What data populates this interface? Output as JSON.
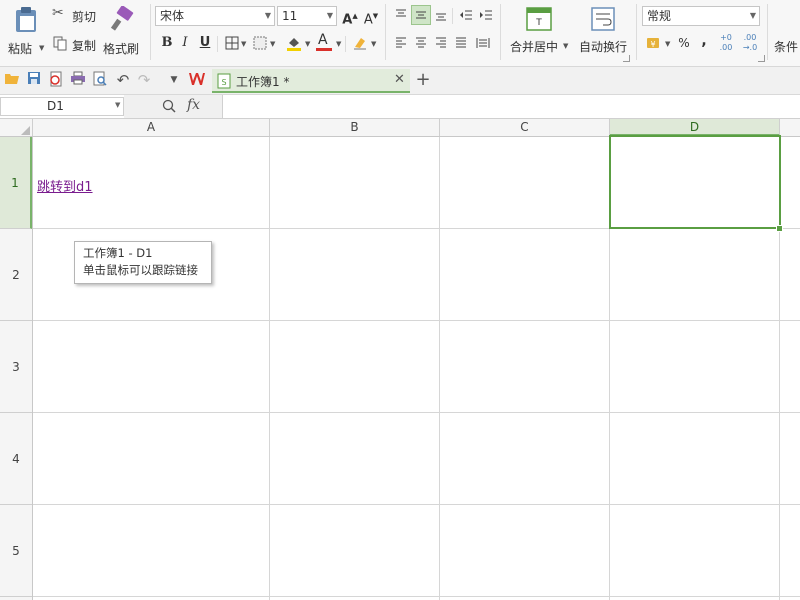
{
  "ribbon": {
    "paste_label": "粘贴",
    "cut_label": "剪切",
    "copy_label": "复制",
    "format_painter_label": "格式刷",
    "font_name": "宋体",
    "font_size": "11",
    "bold": "B",
    "italic": "I",
    "underline": "U",
    "merge_center_label": "合并居中",
    "wrap_text_label": "自动换行",
    "number_format": "常规",
    "percent": "%",
    "comma": ",",
    "conditional_label": "条件"
  },
  "quickbar": {
    "doc_tab_title": "工作簿1 *",
    "add_tab": "+"
  },
  "formula_bar": {
    "name_box": "D1",
    "fx": "fx"
  },
  "grid": {
    "columns": [
      "A",
      "B",
      "C",
      "D"
    ],
    "rows": [
      "1",
      "2",
      "3",
      "4",
      "5"
    ],
    "selected_column": "D",
    "selected_row": "1",
    "hyperlink_text": "跳转到d1"
  },
  "tooltip": {
    "line1": "工作簿1 - D1",
    "line2": "单击鼠标可以跟踪链接"
  },
  "colors": {
    "accent_green": "#5a9e42",
    "hyperlink": "#7a1c8e",
    "wps_red": "#d9302a"
  }
}
